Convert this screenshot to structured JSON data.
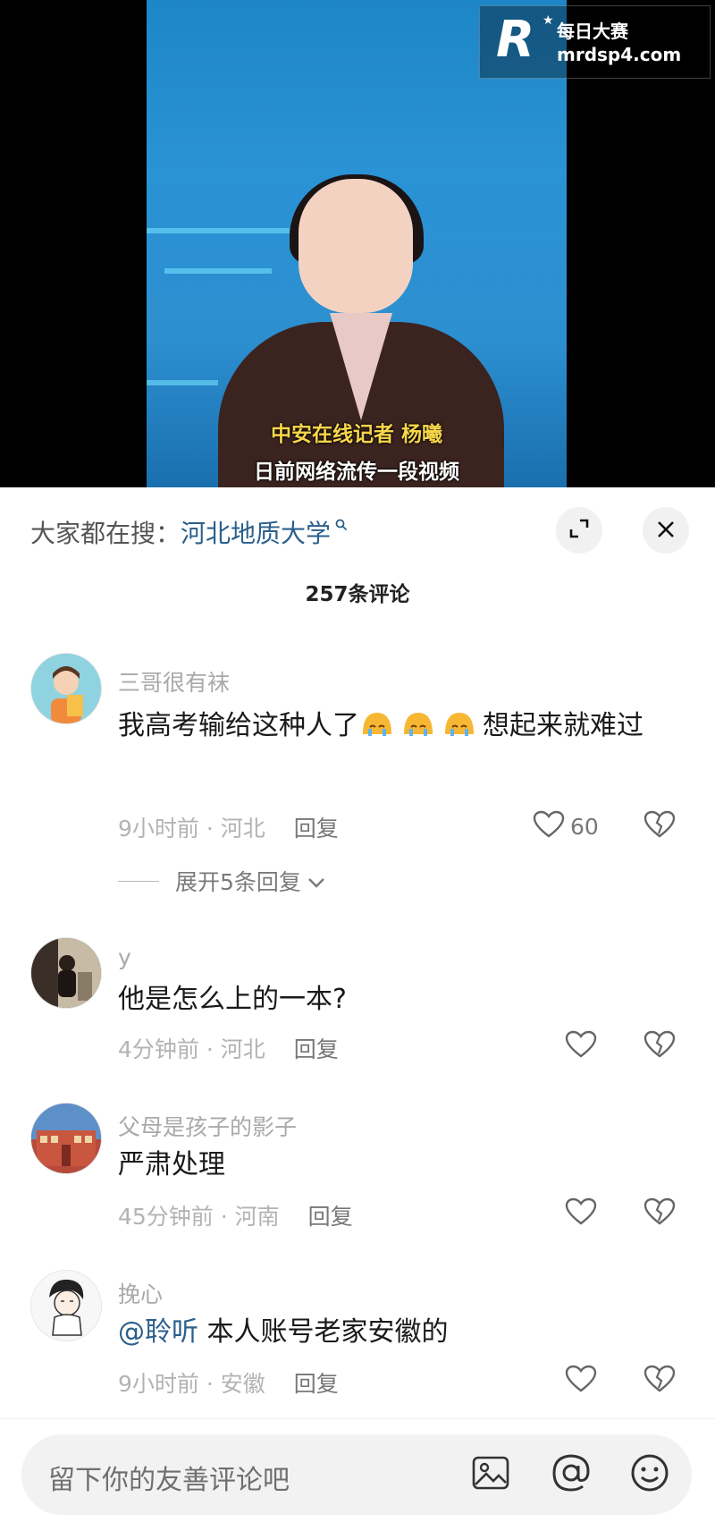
{
  "video": {
    "caption_line1": "中安在线记者 杨曦",
    "caption_line2": "日前网络流传一段视频",
    "watermark_brand": "每日大赛",
    "watermark_url": "mrdsp4.com"
  },
  "sheet": {
    "search_prefix": "大家都在搜：",
    "search_keyword": "河北地质大学",
    "comment_count": "257条评论"
  },
  "comments": [
    {
      "user": "三哥很有袜",
      "text_before": "我高考输给这种人了",
      "text_after": "想起来就难过",
      "time_loc": "9小时前 · 河北",
      "reply_label": "回复",
      "likes": "60",
      "expand_label": "展开5条回复"
    },
    {
      "user": "y",
      "text": "他是怎么上的一本?",
      "time_loc": "4分钟前 · 河北",
      "reply_label": "回复"
    },
    {
      "user": "父母是孩子的影子",
      "text": "严肃处理",
      "time_loc": "45分钟前 · 河南",
      "reply_label": "回复"
    },
    {
      "user": "挽心",
      "mention": "@聆听",
      "text": " 本人账号老家安徽的",
      "time_loc": "9小时前 · 安徽",
      "reply_label": "回复"
    }
  ],
  "input": {
    "placeholder": "留下你的友善评论吧"
  },
  "icons": {
    "expand": "expand-icon",
    "close": "close-icon",
    "like": "heart-icon",
    "dislike": "broken-heart-icon",
    "image": "image-icon",
    "mention": "at-icon",
    "emoji": "emoji-icon"
  }
}
